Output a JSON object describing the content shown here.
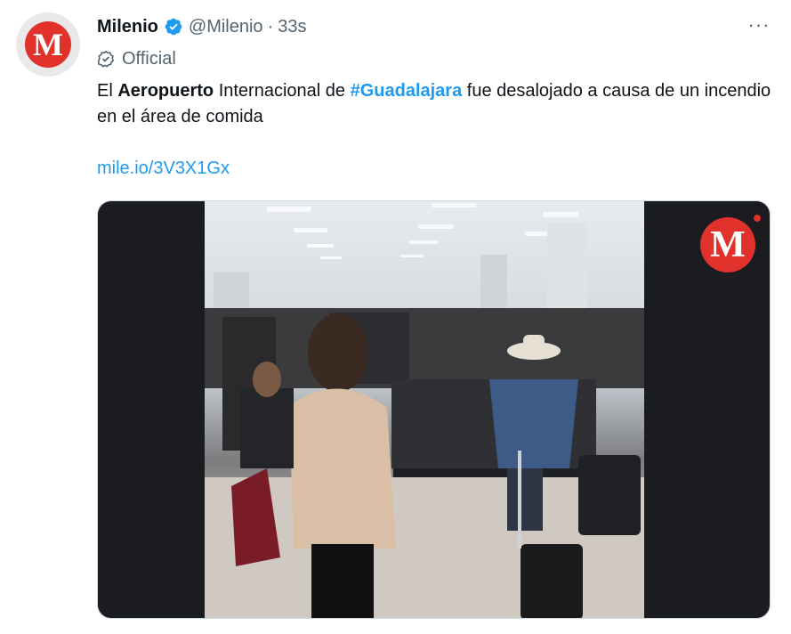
{
  "tweet": {
    "author_name": "Milenio",
    "handle": "@Milenio",
    "separator": "·",
    "time": "33s",
    "official_label": "Official",
    "more": "···",
    "avatar_letter": "M",
    "text": {
      "part1": "El ",
      "bold": "Aeropuerto",
      "part2": " Internacional de ",
      "hashtag": "#Guadalajara",
      "part3": " fue desalojado a causa de un incendio en el área de comida"
    },
    "link": "mile.io/3V3X1Gx",
    "video_logo_letter": "M"
  },
  "colors": {
    "accent": "#1d9bf0",
    "brand_red": "#e0322b",
    "secondary_text": "#536471"
  },
  "icons": [
    "verified-badge-icon",
    "official-check-icon",
    "more-options-icon"
  ]
}
